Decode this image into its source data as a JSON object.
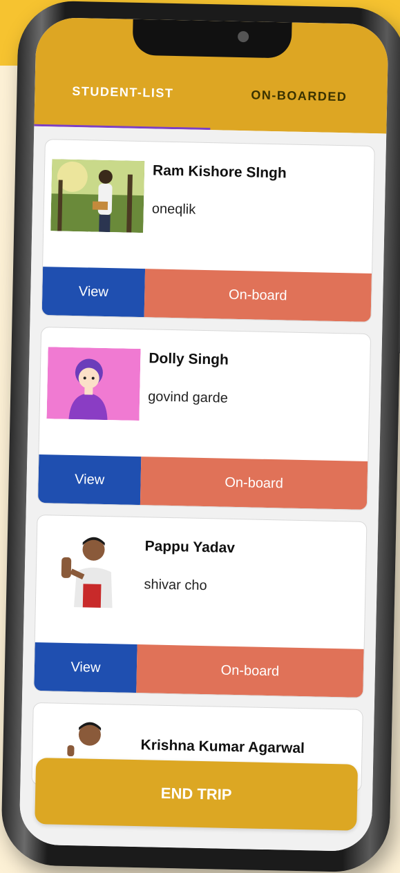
{
  "tabs": [
    {
      "label": "STUDENT-LIST",
      "active": true
    },
    {
      "label": "ON-BOARDED",
      "active": false
    }
  ],
  "students": [
    {
      "name": "Ram Kishore SIngh",
      "subtitle": "oneqlik",
      "photo": "girl-with-book-photo"
    },
    {
      "name": "Dolly  Singh",
      "subtitle": "govind garde",
      "photo": "cartoon-avatar"
    },
    {
      "name": "Pappu Yadav",
      "subtitle": "shivar cho",
      "photo": "boy-thumbs-up-photo"
    },
    {
      "name": "Krishna Kumar Agarwal",
      "subtitle": "",
      "photo": "boy-thumbs-up-photo"
    }
  ],
  "actions": {
    "view_label": "View",
    "onboard_label": "On-board"
  },
  "footer": {
    "end_trip_label": "END TRIP"
  },
  "colors": {
    "appbar": "#dda623",
    "tab_indicator": "#7b3fc6",
    "view_button": "#1f4fb0",
    "onboard_button": "#e07258",
    "end_trip_button": "#dca723"
  }
}
